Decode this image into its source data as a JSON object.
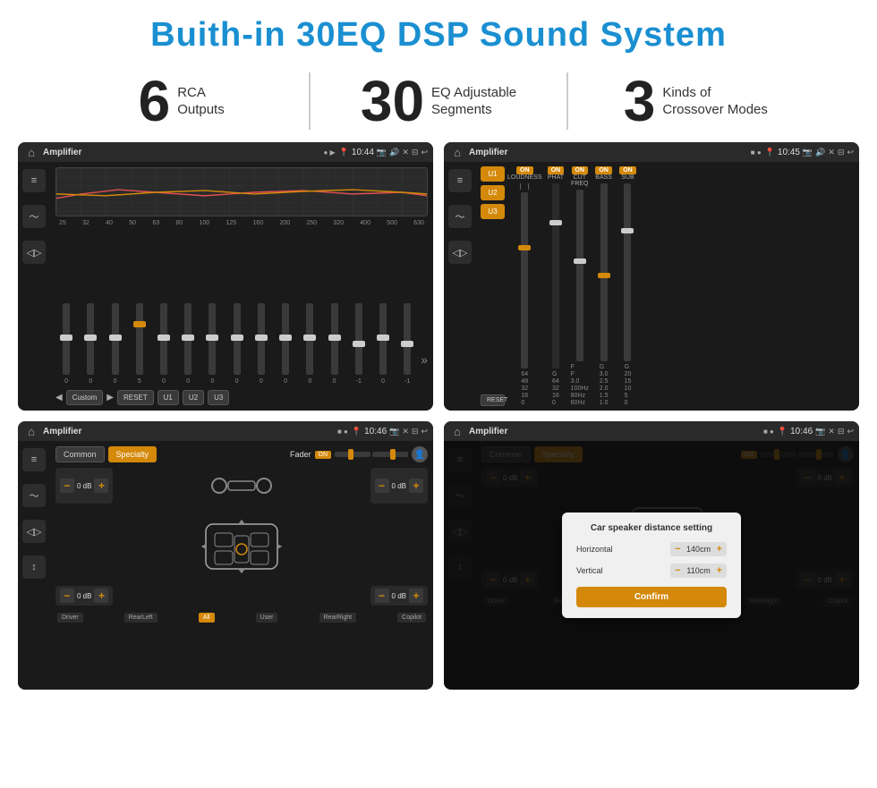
{
  "page": {
    "title": "Buith-in 30EQ DSP Sound System",
    "stats": [
      {
        "number": "6",
        "label": "RCA\nOutputs"
      },
      {
        "number": "30",
        "label": "EQ Adjustable\nSegments"
      },
      {
        "number": "3",
        "label": "Kinds of\nCrossover Modes"
      }
    ],
    "screens": [
      {
        "id": "eq-screen",
        "title": "Amplifier",
        "time": "10:44",
        "type": "equalizer",
        "eq_freqs": [
          "25",
          "32",
          "40",
          "50",
          "63",
          "80",
          "100",
          "125",
          "160",
          "200",
          "250",
          "320",
          "400",
          "500",
          "630"
        ],
        "eq_values": [
          "0",
          "0",
          "0",
          "5",
          "0",
          "0",
          "0",
          "0",
          "0",
          "0",
          "0",
          "0",
          "-1",
          "0",
          "-1"
        ],
        "eq_slider_positions": [
          50,
          50,
          50,
          30,
          50,
          50,
          50,
          50,
          50,
          50,
          50,
          50,
          60,
          50,
          60
        ],
        "preset": "Custom",
        "buttons": [
          "RESET",
          "U1",
          "U2",
          "U3"
        ]
      },
      {
        "id": "crossover-screen",
        "title": "Amplifier",
        "time": "10:45",
        "type": "crossover",
        "u_buttons": [
          "U1",
          "U2",
          "U3"
        ],
        "cols": [
          {
            "label": "LOUDNESS",
            "on": true
          },
          {
            "label": "PHAT",
            "on": true
          },
          {
            "label": "CUT FREQ",
            "on": true
          },
          {
            "label": "BASS",
            "on": true
          },
          {
            "label": "SUB",
            "on": true
          }
        ],
        "reset_label": "RESET"
      },
      {
        "id": "fader-screen",
        "title": "Amplifier",
        "time": "10:46",
        "type": "fader",
        "tabs": [
          "Common",
          "Specialty"
        ],
        "active_tab": "Specialty",
        "fader_label": "Fader",
        "fader_on": "ON",
        "db_values": [
          "0 dB",
          "0 dB",
          "0 dB",
          "0 dB"
        ],
        "labels": [
          "Driver",
          "RearLeft",
          "All",
          "User",
          "RearRight",
          "Copilot"
        ]
      },
      {
        "id": "dialog-screen",
        "title": "Amplifier",
        "time": "10:46",
        "type": "dialog",
        "tabs": [
          "Common",
          "Specialty"
        ],
        "active_tab": "Specialty",
        "dialog": {
          "title": "Car speaker distance setting",
          "horizontal_label": "Horizontal",
          "horizontal_value": "140cm",
          "vertical_label": "Vertical",
          "vertical_value": "110cm",
          "confirm_label": "Confirm"
        },
        "labels": [
          "Driver",
          "RearLeft",
          "All",
          "User",
          "RearRight",
          "Copilot"
        ]
      }
    ]
  }
}
